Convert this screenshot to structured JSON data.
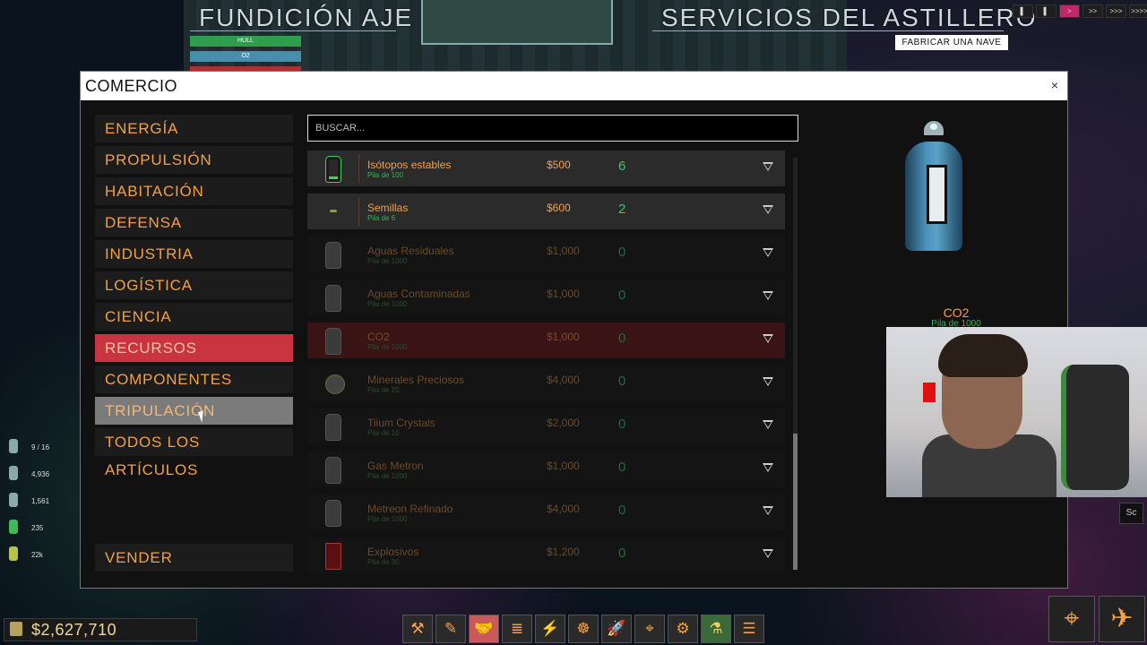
{
  "station": {
    "left_title": "FUNDICIÓN AJE",
    "right_title": "SERVICIOS DEL ASTILLERO",
    "build_button": "FABRICAR UNA NAVE",
    "bar_hull": "HULL",
    "bar_o2": "O2",
    "speed_buttons": [
      "▌",
      "▌",
      ">",
      ">>",
      ">>>",
      ">>>>"
    ]
  },
  "modal": {
    "title": "COMERCIO",
    "close": "×"
  },
  "categories": [
    "ENERGÍA",
    "PROPULSIÓN",
    "HABITACIÓN",
    "DEFENSA",
    "INDUSTRIA",
    "LOGÍSTICA",
    "CIENCIA",
    "RECURSOS",
    "COMPONENTES",
    "TRIPULACIÓN",
    "TODOS LOS ARTÍCULOS"
  ],
  "sell_label": "VENDER",
  "search": {
    "placeholder": "BUSCAR..."
  },
  "items": [
    {
      "name": "Isótopos estables",
      "stack": "Pila de 100",
      "price": "$500",
      "qty": "6"
    },
    {
      "name": "Semillas",
      "stack": "Pila de 6",
      "price": "$600",
      "qty": "2"
    },
    {
      "name": "Aguas Residuales",
      "stack": "Pila de 1000",
      "price": "$1,000",
      "qty": "0"
    },
    {
      "name": "Aguas Contaminadas",
      "stack": "Pila de 1000",
      "price": "$1,000",
      "qty": "0"
    },
    {
      "name": "CO2",
      "stack": "Pila de 1000",
      "price": "$1,000",
      "qty": "0"
    },
    {
      "name": "Minerales Preciosos",
      "stack": "Pila de 20",
      "price": "$4,000",
      "qty": "0"
    },
    {
      "name": "Tiium Crystals",
      "stack": "Pila de 10",
      "price": "$2,000",
      "qty": "0"
    },
    {
      "name": "Gas Metron",
      "stack": "Pila de 1000",
      "price": "$1,000",
      "qty": "0"
    },
    {
      "name": "Metreon Refinado",
      "stack": "Pila de 1000",
      "price": "$4,000",
      "qty": "0"
    },
    {
      "name": "Explosivos",
      "stack": "Pila de 30",
      "price": "$1,200",
      "qty": "0"
    }
  ],
  "preview": {
    "name": "CO2",
    "stack": "Pila de 1000"
  },
  "stats": [
    "9 / 16",
    "4,936",
    "1,561",
    "235",
    "22k"
  ],
  "sc_label": "Sc",
  "money": "$2,627,710",
  "toolbar": [
    "⚒",
    "✎",
    "🤝",
    "≣",
    "⚡",
    "☸",
    "🚀",
    "⌖",
    "⚙",
    "⚗",
    "☰"
  ],
  "big_buttons": [
    "⌖",
    "✈"
  ]
}
